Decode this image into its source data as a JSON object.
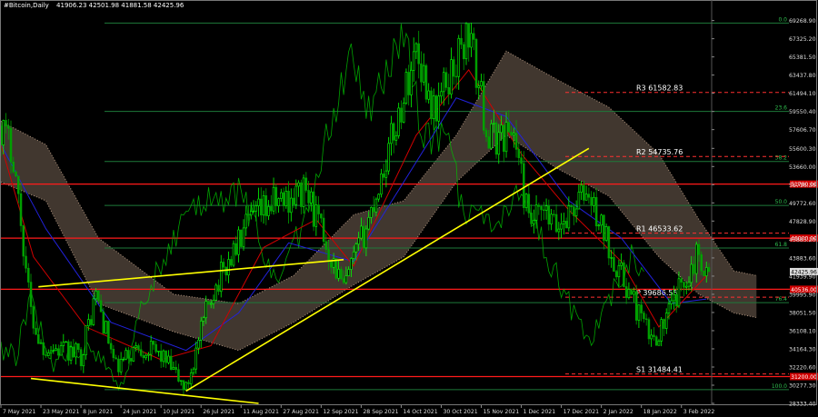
{
  "header": {
    "symbol_period": "#Bitcoin,Daily",
    "ohlc": "41906.23 42501.98 41881.58 42425.96"
  },
  "colors": {
    "background": "#000000",
    "grid": "#3a3a3a",
    "bull": "#00ff00",
    "bear": "#00a000",
    "lagging": "#00c000",
    "tenkan": "#d00000",
    "kijun": "#2222dd",
    "kumo": "#d7b59a",
    "resistance_line": "#ff1a1a",
    "pivot_line": "#ff3030",
    "fib_line": "#1e7a3a",
    "trendline": "#ffff00",
    "axis_text": "#dcdcdc",
    "pivot_text": "#ffffff",
    "fib_text": "#2fbf4f",
    "price_tag_bg": "#d00000"
  },
  "chart_data": {
    "type": "candlestick",
    "y_axis": {
      "side": "right",
      "range": [
        28333.4,
        70300
      ],
      "tick_labels": [
        "69268.90",
        "67325.20",
        "65381.50",
        "63437.80",
        "61494.10",
        "59550.40",
        "57606.70",
        "55600.30",
        "53660.00",
        "51716.30",
        "49772.60",
        "47828.90",
        "45885.20",
        "43883.60",
        "41939.90",
        "39995.90",
        "38051.50",
        "36108.10",
        "34164.30",
        "32220.60",
        "30277.30",
        "28333.40"
      ]
    },
    "x_axis": {
      "tick_labels": [
        "7 May 2021",
        "23 May 2021",
        "8 Jun 2021",
        "24 Jun 2021",
        "10 Jul 2021",
        "26 Jul 2021",
        "11 Aug 2021",
        "27 Aug 2021",
        "12 Sep 2021",
        "28 Sep 2021",
        "14 Oct 2021",
        "30 Oct 2021",
        "15 Nov 2021",
        "1 Dec 2021",
        "17 Dec 2021",
        "2 Jan 2022",
        "18 Jan 2022",
        "3 Feb 2022"
      ],
      "start_date": "2021-05-07",
      "end_date": "2022-02-14"
    },
    "price_path_dates": [
      "2021-05-07",
      "2021-05-12",
      "2021-05-19",
      "2021-05-23",
      "2021-06-08",
      "2021-06-14",
      "2021-06-22",
      "2021-07-01",
      "2021-07-10",
      "2021-07-20",
      "2021-07-30",
      "2021-08-14",
      "2021-08-22",
      "2021-09-06",
      "2021-09-21",
      "2021-10-01",
      "2021-10-15",
      "2021-10-20",
      "2021-10-27",
      "2021-11-10",
      "2021-11-18",
      "2021-11-28",
      "2021-12-04",
      "2021-12-10",
      "2021-12-15",
      "2021-12-27",
      "2022-01-10",
      "2022-01-22",
      "2022-01-27",
      "2022-02-04",
      "2022-02-10",
      "2022-02-13"
    ],
    "price_path_values": [
      58000,
      55000,
      38000,
      34500,
      33500,
      40000,
      32000,
      34500,
      33500,
      29800,
      40000,
      47500,
      49500,
      51000,
      40500,
      48000,
      61000,
      66500,
      59500,
      68000,
      56500,
      57500,
      47500,
      48500,
      47000,
      51000,
      42000,
      35000,
      36800,
      41500,
      44500,
      42425.96
    ],
    "tenkan_dates": [
      "2021-05-07",
      "2021-05-20",
      "2021-06-10",
      "2021-07-10",
      "2021-07-30",
      "2021-08-20",
      "2021-09-10",
      "2021-09-25",
      "2021-10-20",
      "2021-11-10",
      "2021-12-01",
      "2021-12-20",
      "2022-01-10",
      "2022-01-25",
      "2022-02-13"
    ],
    "tenkan_values": [
      56000,
      44000,
      36500,
      33000,
      34500,
      45000,
      48000,
      43000,
      57000,
      64000,
      55000,
      49000,
      43500,
      36500,
      42000
    ],
    "kijun_dates": [
      "2021-05-07",
      "2021-05-25",
      "2021-06-20",
      "2021-07-20",
      "2021-08-10",
      "2021-08-30",
      "2021-09-25",
      "2021-10-15",
      "2021-11-05",
      "2021-11-25",
      "2021-12-20",
      "2022-01-10",
      "2022-01-30",
      "2022-02-13"
    ],
    "kijun_values": [
      56000,
      47000,
      37000,
      34000,
      38000,
      45500,
      43500,
      52000,
      61000,
      59000,
      50000,
      46000,
      39000,
      39500
    ],
    "kumo_dates": [
      "2021-05-07",
      "2021-05-25",
      "2021-06-15",
      "2021-07-15",
      "2021-08-10",
      "2021-09-01",
      "2021-09-25",
      "2021-10-15",
      "2021-11-05",
      "2021-11-25",
      "2021-12-15",
      "2022-01-05",
      "2022-01-25",
      "2022-02-10",
      "2022-02-24",
      "2022-03-05"
    ],
    "kumo_upper": [
      58500,
      56000,
      46000,
      40000,
      39000,
      42000,
      48500,
      50000,
      57000,
      66000,
      63000,
      60000,
      55000,
      48000,
      42500,
      42000
    ],
    "kumo_lower": [
      52000,
      50000,
      39000,
      36000,
      34000,
      37000,
      41000,
      44000,
      52000,
      57000,
      53500,
      50500,
      44000,
      40000,
      38000,
      37500
    ],
    "trendlines": [
      {
        "from_date": "2021-05-22",
        "from_value": 40800,
        "to_date": "2021-09-21",
        "to_value": 43700
      },
      {
        "from_date": "2021-05-19",
        "from_value": 31000,
        "to_date": "2021-08-18",
        "to_value": 28333.4
      },
      {
        "from_date": "2021-07-20",
        "from_value": 29650,
        "to_date": "2021-12-28",
        "to_value": 55600
      }
    ],
    "horizontal_levels": [
      {
        "kind": "resistance",
        "value": 51780,
        "tag": "51780.00"
      },
      {
        "kind": "resistance",
        "value": 46000,
        "tag": "46000.00"
      },
      {
        "kind": "resistance",
        "value": 40536,
        "tag": "40536.00"
      },
      {
        "kind": "resistance",
        "value": 31200,
        "tag": "31200.00"
      }
    ],
    "pivots": [
      {
        "label": "R3 61582.83",
        "value": 61582.83
      },
      {
        "label": "R2 54735.76",
        "value": 54735.76
      },
      {
        "label": "R1 46533.62",
        "value": 46533.62
      },
      {
        "label": "P 39686.55",
        "value": 39686.55
      },
      {
        "label": "S1 31484.41",
        "value": 31484.41
      }
    ],
    "fibonacci": [
      {
        "label": "0.0",
        "value": 69000
      },
      {
        "label": "23.6",
        "value": 59550
      },
      {
        "label": "38.2",
        "value": 54200
      },
      {
        "label": "50.0",
        "value": 49500
      },
      {
        "label": "61.8",
        "value": 44950
      },
      {
        "label": "76.4",
        "value": 39100
      },
      {
        "label": "100.0",
        "value": 29800
      }
    ],
    "current_price": {
      "value": 42425.96,
      "tag": "42425.96"
    },
    "grid": false,
    "legend": "none"
  }
}
